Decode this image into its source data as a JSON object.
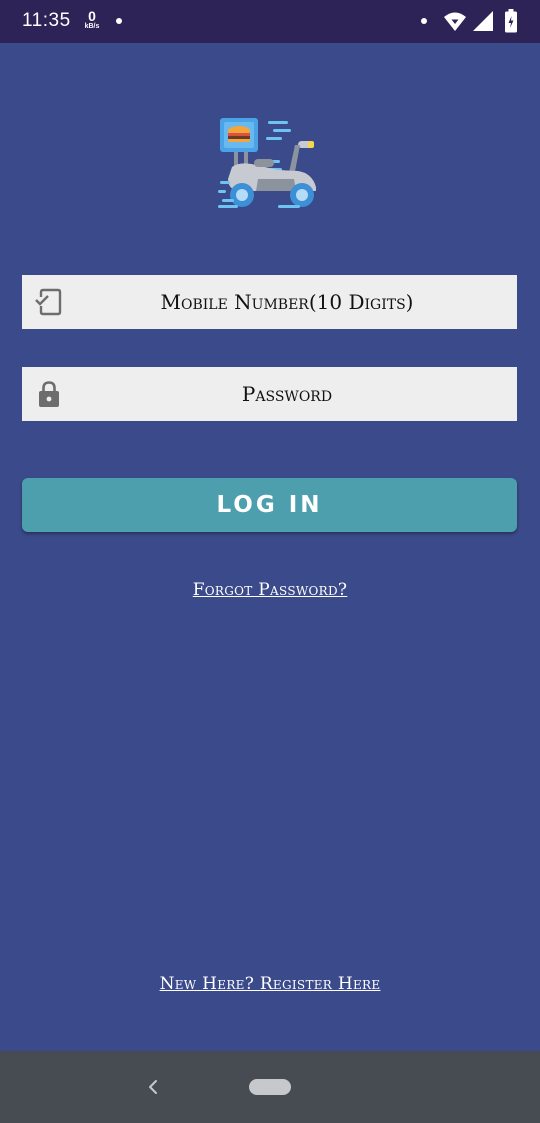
{
  "status_bar": {
    "time": "11:35",
    "net_speed_value": "0",
    "net_speed_unit": "kB/s",
    "icons": [
      "notification-dot-icon",
      "wifi-icon",
      "signal-icon",
      "battery-icon"
    ]
  },
  "logo": {
    "icon": "food-delivery-scooter-icon"
  },
  "form": {
    "mobile": {
      "placeholder": "Mobile Number(10 Digits)",
      "value": "",
      "icon": "phone-check-icon"
    },
    "password": {
      "placeholder": "Password",
      "value": "",
      "icon": "lock-icon"
    },
    "login_label": "LOG IN"
  },
  "links": {
    "forgot_password": "Forgot Password?",
    "register": "New Here? Register Here"
  },
  "nav_bar": {
    "icons": [
      "back-icon",
      "home-pill-icon"
    ]
  },
  "colors": {
    "background": "#3b4a8a",
    "status_bar": "#2e2356",
    "input_background": "#eeeeee",
    "button": "#4e9fae",
    "nav_bar": "#474c53"
  }
}
